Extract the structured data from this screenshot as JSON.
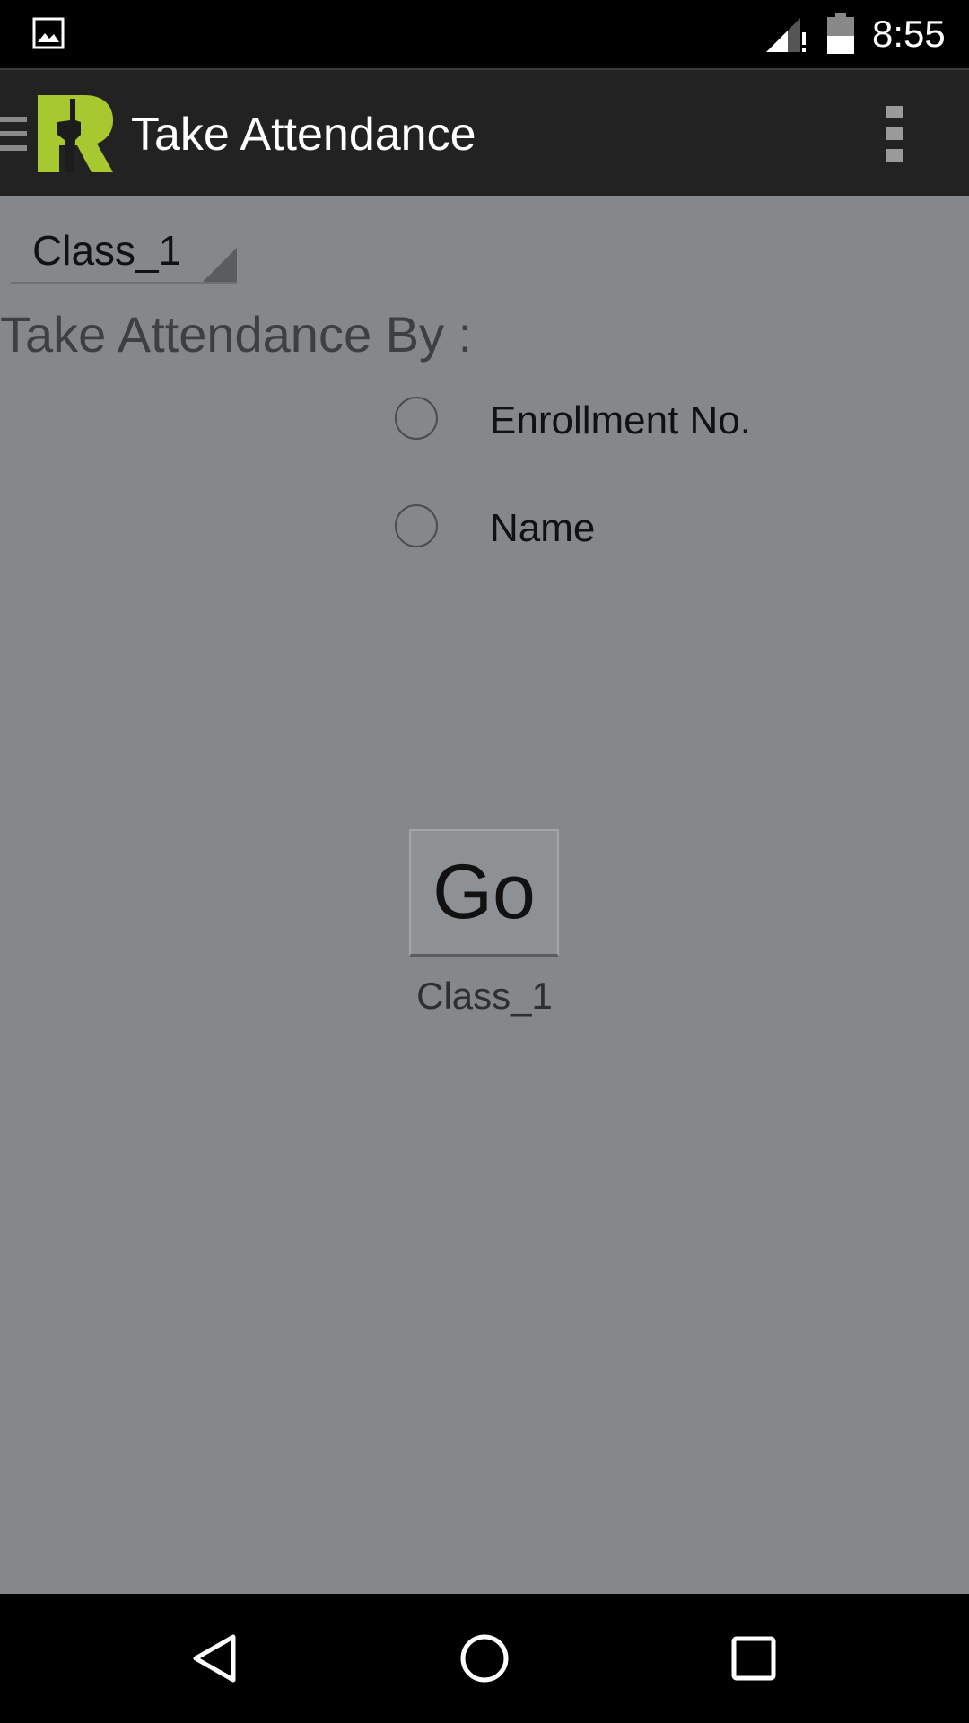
{
  "status_bar": {
    "time": "8:55",
    "icons": [
      "gallery-icon",
      "signal-icon",
      "battery-icon"
    ]
  },
  "action_bar": {
    "title": "Take Attendance",
    "icons": [
      "drawer-icon",
      "app-logo",
      "overflow-menu-icon"
    ],
    "logo_color": "#a7c92f"
  },
  "form": {
    "class_spinner_value": "Class_1",
    "section_label": "Take Attendance By :",
    "options": [
      {
        "label": "Enrollment No.",
        "selected": false
      },
      {
        "label": "Name",
        "selected": false
      }
    ],
    "go_label": "Go",
    "class_caption": "Class_1"
  },
  "nav_bar": {
    "icons": [
      "back-icon",
      "home-icon",
      "recents-icon"
    ]
  },
  "colors": {
    "content_background": "#85888b",
    "action_bar_background": "#222222"
  }
}
